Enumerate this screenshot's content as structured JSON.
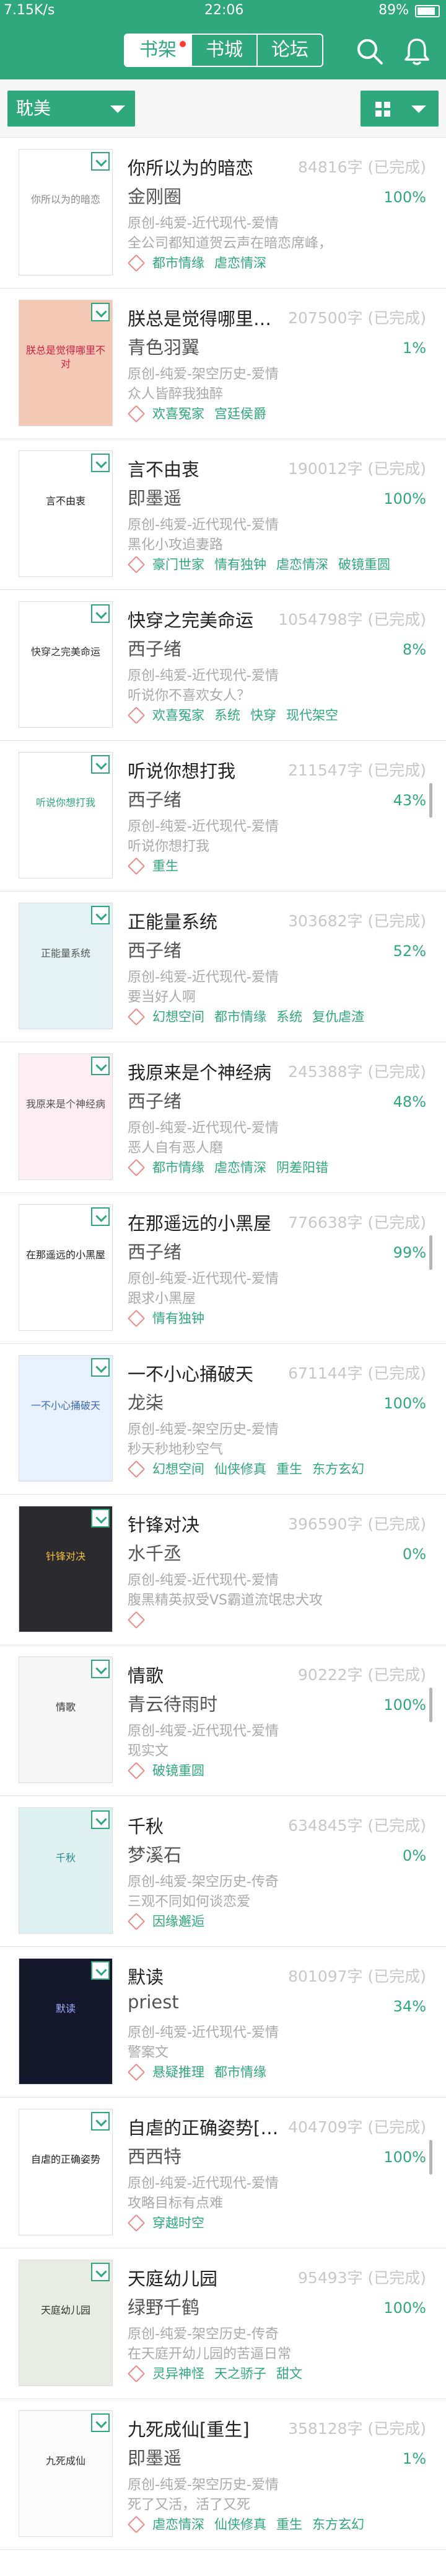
{
  "status": {
    "left": "7.15K/s",
    "time": "22:06",
    "battery": "89%",
    "battery_level": 0.89
  },
  "tabs": [
    {
      "label": "书架",
      "active": true
    },
    {
      "label": "书城",
      "active": false
    },
    {
      "label": "论坛",
      "active": false
    }
  ],
  "filter": {
    "category": "耽美",
    "view": "grid"
  },
  "colors": {
    "brand": "#2fa87d",
    "tag_icon": "#f08a8a"
  },
  "books": [
    {
      "title": "你所以为的暗恋",
      "words": "84816字 (已完成)",
      "author": "金刚圈",
      "progress": "100%",
      "category": "原创-纯爱-近代现代-爱情",
      "intro": "全公司都知道贺云声在暗恋席峰，",
      "tags": [
        "都市情缘",
        "虐恋情深"
      ],
      "cover": {
        "bg": "#ffffff",
        "fg": "#8a8a8a",
        "text": "你所以为的暗恋"
      }
    },
    {
      "title": "朕总是觉得哪里…",
      "words": "207500字 (已完成)",
      "author": "青色羽翼",
      "progress": "1%",
      "category": "原创-纯爱-架空历史-爱情",
      "intro": "众人皆醉我独醉",
      "tags": [
        "欢喜冤家",
        "宫廷侯爵"
      ],
      "cover": {
        "bg": "#f3c9b6",
        "fg": "#d02040",
        "text": "朕总是觉得哪里不对"
      }
    },
    {
      "title": "言不由衷",
      "words": "190012字 (已完成)",
      "author": "即墨遥",
      "progress": "100%",
      "category": "原创-纯爱-近代现代-爱情",
      "intro": "黑化小攻追妻路",
      "tags": [
        "豪门世家",
        "情有独钟",
        "虐恋情深",
        "破镜重圆"
      ],
      "cover": {
        "bg": "#ffffff",
        "fg": "#222222",
        "text": "言不由衷"
      }
    },
    {
      "title": "快穿之完美命运",
      "words": "1054798字 (已完成)",
      "author": "西子绪",
      "progress": "8%",
      "category": "原创-纯爱-近代现代-爱情",
      "intro": "听说你不喜欢女人？",
      "tags": [
        "欢喜冤家",
        "系统",
        "快穿",
        "现代架空"
      ],
      "cover": {
        "bg": "#ffffff",
        "fg": "#333333",
        "text": "快穿之完美命运"
      }
    },
    {
      "title": "听说你想打我",
      "words": "211547字 (已完成)",
      "author": "西子绪",
      "progress": "43%",
      "category": "原创-纯爱-近代现代-爱情",
      "intro": "听说你想打我",
      "tags": [
        "重生"
      ],
      "cover": {
        "bg": "#ffffff",
        "fg": "#2fa87d",
        "text": "听说你想打我"
      }
    },
    {
      "title": "正能量系统",
      "words": "303682字 (已完成)",
      "author": "西子绪",
      "progress": "52%",
      "category": "原创-纯爱-近代现代-爱情",
      "intro": "要当好人啊",
      "tags": [
        "幻想空间",
        "都市情缘",
        "系统",
        "复仇虐渣"
      ],
      "cover": {
        "bg": "#e4f2f6",
        "fg": "#555555",
        "text": "正能量系统"
      }
    },
    {
      "title": "我原来是个神经病",
      "words": "245388字 (已完成)",
      "author": "西子绪",
      "progress": "48%",
      "category": "原创-纯爱-近代现代-爱情",
      "intro": "恶人自有恶人磨",
      "tags": [
        "都市情缘",
        "虐恋情深",
        "阴差阳错"
      ],
      "cover": {
        "bg": "#fdeef4",
        "fg": "#555555",
        "text": "我原来是个神经病"
      }
    },
    {
      "title": "在那遥远的小黑屋",
      "words": "776638字 (已完成)",
      "author": "西子绪",
      "progress": "99%",
      "category": "原创-纯爱-近代现代-爱情",
      "intro": "跟求小黑屋",
      "tags": [
        "情有独钟"
      ],
      "cover": {
        "bg": "#ffffff",
        "fg": "#222222",
        "text": "在那遥远的小黑屋"
      }
    },
    {
      "title": "一不小心捅破天",
      "words": "671144字 (已完成)",
      "author": "龙柒",
      "progress": "100%",
      "category": "原创-纯爱-架空历史-爱情",
      "intro": "秒天秒地秒空气",
      "tags": [
        "幻想空间",
        "仙侠修真",
        "重生",
        "东方玄幻"
      ],
      "cover": {
        "bg": "#e8f1fb",
        "fg": "#3a6bb5",
        "text": "一不小心捅破天"
      }
    },
    {
      "title": "针锋对决",
      "words": "396590字 (已完成)",
      "author": "水千丞",
      "progress": "0%",
      "category": "原创-纯爱-近代现代-爱情",
      "intro": "腹黑精英叔受VS霸道流氓忠犬攻",
      "tags": [],
      "cover": {
        "bg": "#2b2a2f",
        "fg": "#f0c040",
        "text": "针锋对决"
      }
    },
    {
      "title": "情歌",
      "words": "90222字 (已完成)",
      "author": "青云待雨时",
      "progress": "100%",
      "category": "原创-纯爱-近代现代-爱情",
      "intro": "现实文",
      "tags": [
        "破镜重圆"
      ],
      "cover": {
        "bg": "#f6f6f6",
        "fg": "#333333",
        "text": "情歌"
      }
    },
    {
      "title": "千秋",
      "words": "634845字 (已完成)",
      "author": "梦溪石",
      "progress": "0%",
      "category": "原创-纯爱-架空历史-传奇",
      "intro": "三观不同如何谈恋爱",
      "tags": [
        "因缘邂逅"
      ],
      "cover": {
        "bg": "#dff0f0",
        "fg": "#2a8a8a",
        "text": "千秋"
      }
    },
    {
      "title": "默读",
      "words": "801097字 (已完成)",
      "author": "priest",
      "progress": "34%",
      "category": "原创-纯爱-近代现代-爱情",
      "intro": "警案文",
      "tags": [
        "悬疑推理",
        "都市情缘"
      ],
      "cover": {
        "bg": "#15172a",
        "fg": "#9fb0ff",
        "text": "默读"
      }
    },
    {
      "title": "自虐的正确姿势[…",
      "words": "404709字 (已完成)",
      "author": "西西特",
      "progress": "100%",
      "category": "原创-纯爱-近代现代-爱情",
      "intro": "攻略目标有点难",
      "tags": [
        "穿越时空"
      ],
      "cover": {
        "bg": "#ffffff",
        "fg": "#222222",
        "text": "自虐的正确姿势"
      }
    },
    {
      "title": "天庭幼儿园",
      "words": "95493字 (已完成)",
      "author": "绿野千鹤",
      "progress": "100%",
      "category": "原创-纯爱-架空历史-传奇",
      "intro": "在天庭开幼儿园的苦逼日常",
      "tags": [
        "灵异神怪",
        "天之骄子",
        "甜文"
      ],
      "cover": {
        "bg": "#e9ece4",
        "fg": "#333333",
        "text": "天庭幼儿园"
      }
    },
    {
      "title": "九死成仙[重生]",
      "words": "358128字 (已完成)",
      "author": "即墨遥",
      "progress": "1%",
      "category": "原创-纯爱-架空历史-爱情",
      "intro": "死了又活，活了又死",
      "tags": [
        "虐恋情深",
        "仙侠修真",
        "重生",
        "东方玄幻"
      ],
      "cover": {
        "bg": "#fafafa",
        "fg": "#333333",
        "text": "九死成仙"
      }
    }
  ]
}
